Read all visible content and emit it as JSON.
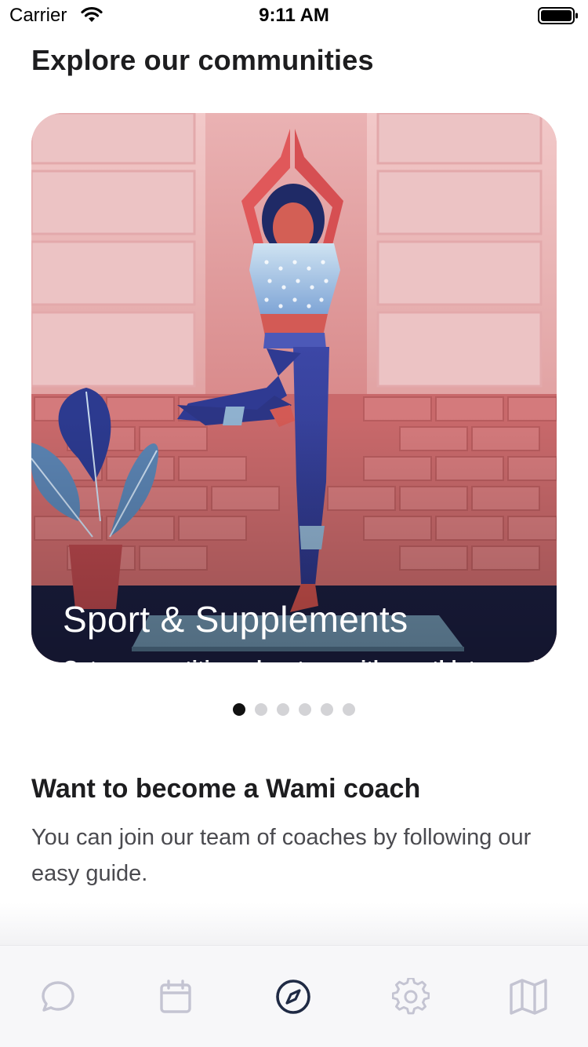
{
  "status_bar": {
    "carrier": "Carrier",
    "time": "9:11 AM",
    "wifi_icon": "wifi-icon",
    "battery_icon": "battery-icon"
  },
  "section_title": "Explore our communities",
  "card": {
    "title": "Sport & Supplements",
    "description": "Get a competitive advantage with an athlete meal plan or effective advice on what multivit, micronutrients or BCAA's to use.",
    "illustration": "yoga-woman-illustration"
  },
  "pager": {
    "count": 6,
    "active_index": 0
  },
  "coach": {
    "title": "Want to become a Wami coach",
    "text": "You can join our team of coaches by following our easy guide."
  },
  "tabbar": {
    "items": [
      {
        "icon": "chat-bubble-icon",
        "active": false
      },
      {
        "icon": "calendar-icon",
        "active": false
      },
      {
        "icon": "compass-icon",
        "active": true
      },
      {
        "icon": "gear-icon",
        "active": false
      },
      {
        "icon": "map-icon",
        "active": false
      }
    ]
  },
  "colors": {
    "active_tab": "#1f2a44",
    "inactive_tab": "#c4c4d2",
    "card_floor": "#1a1d3e",
    "dot_active": "#111111",
    "dot_inactive": "#d3d3d6"
  }
}
